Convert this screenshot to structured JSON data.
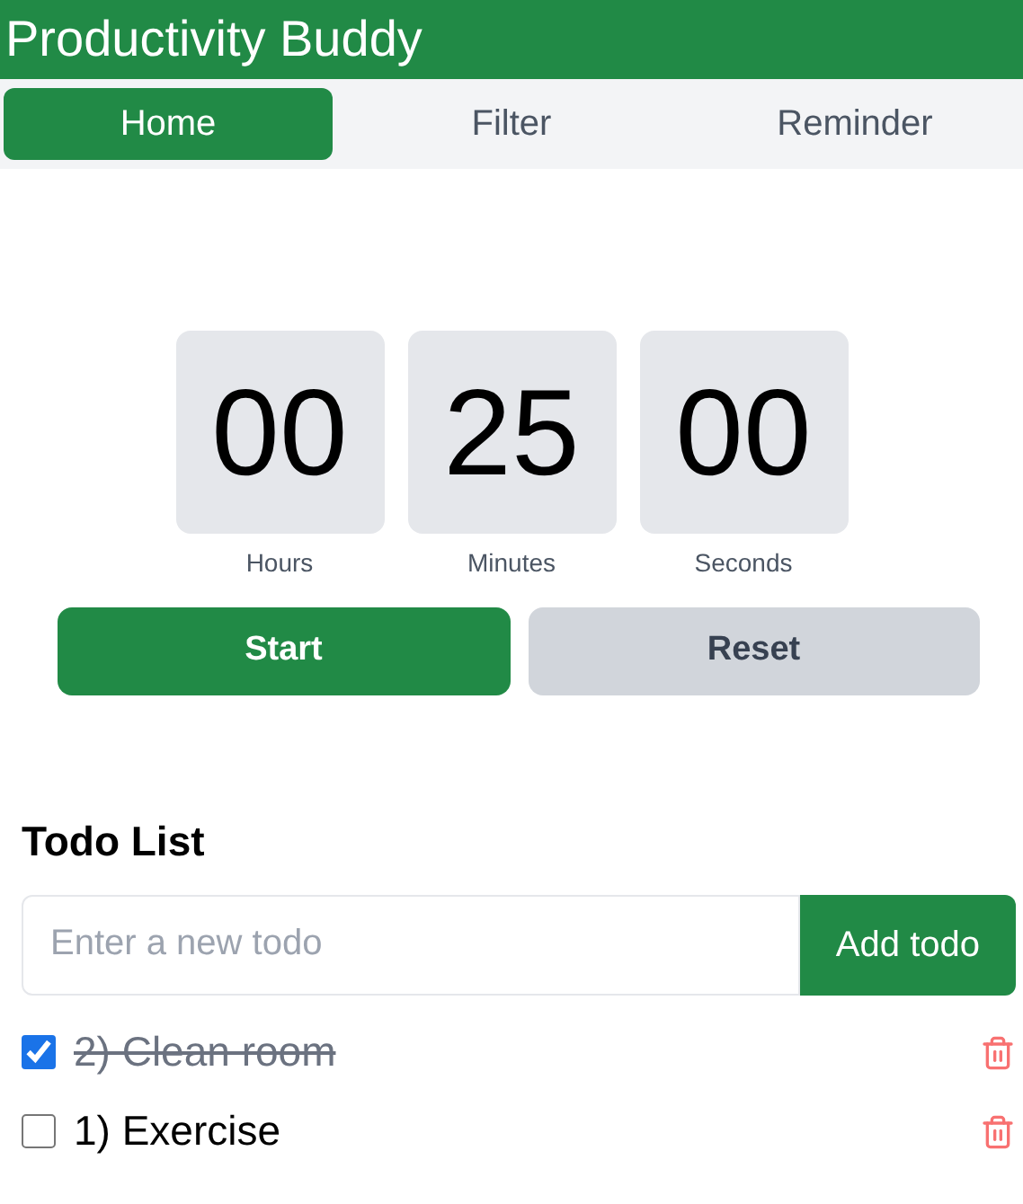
{
  "header": {
    "title": "Productivity Buddy"
  },
  "tabs": [
    {
      "label": "Home",
      "selected": true
    },
    {
      "label": "Filter",
      "selected": false
    },
    {
      "label": "Reminder",
      "selected": false
    }
  ],
  "timer": [
    {
      "value": "00",
      "label": "Hours"
    },
    {
      "value": "25",
      "label": "Minutes"
    },
    {
      "value": "00",
      "label": "Seconds"
    }
  ],
  "buttons": [
    {
      "label": "Start",
      "kind": "primary"
    },
    {
      "label": "Reset",
      "kind": "secondary"
    }
  ],
  "todo": {
    "heading": "Todo List",
    "input": {
      "placeholder": "Enter a new todo"
    },
    "add_button": "Add todo",
    "items": [
      {
        "text": "2) Clean room",
        "checked": true
      },
      {
        "text": "1) Exercise",
        "checked": false
      }
    ]
  }
}
